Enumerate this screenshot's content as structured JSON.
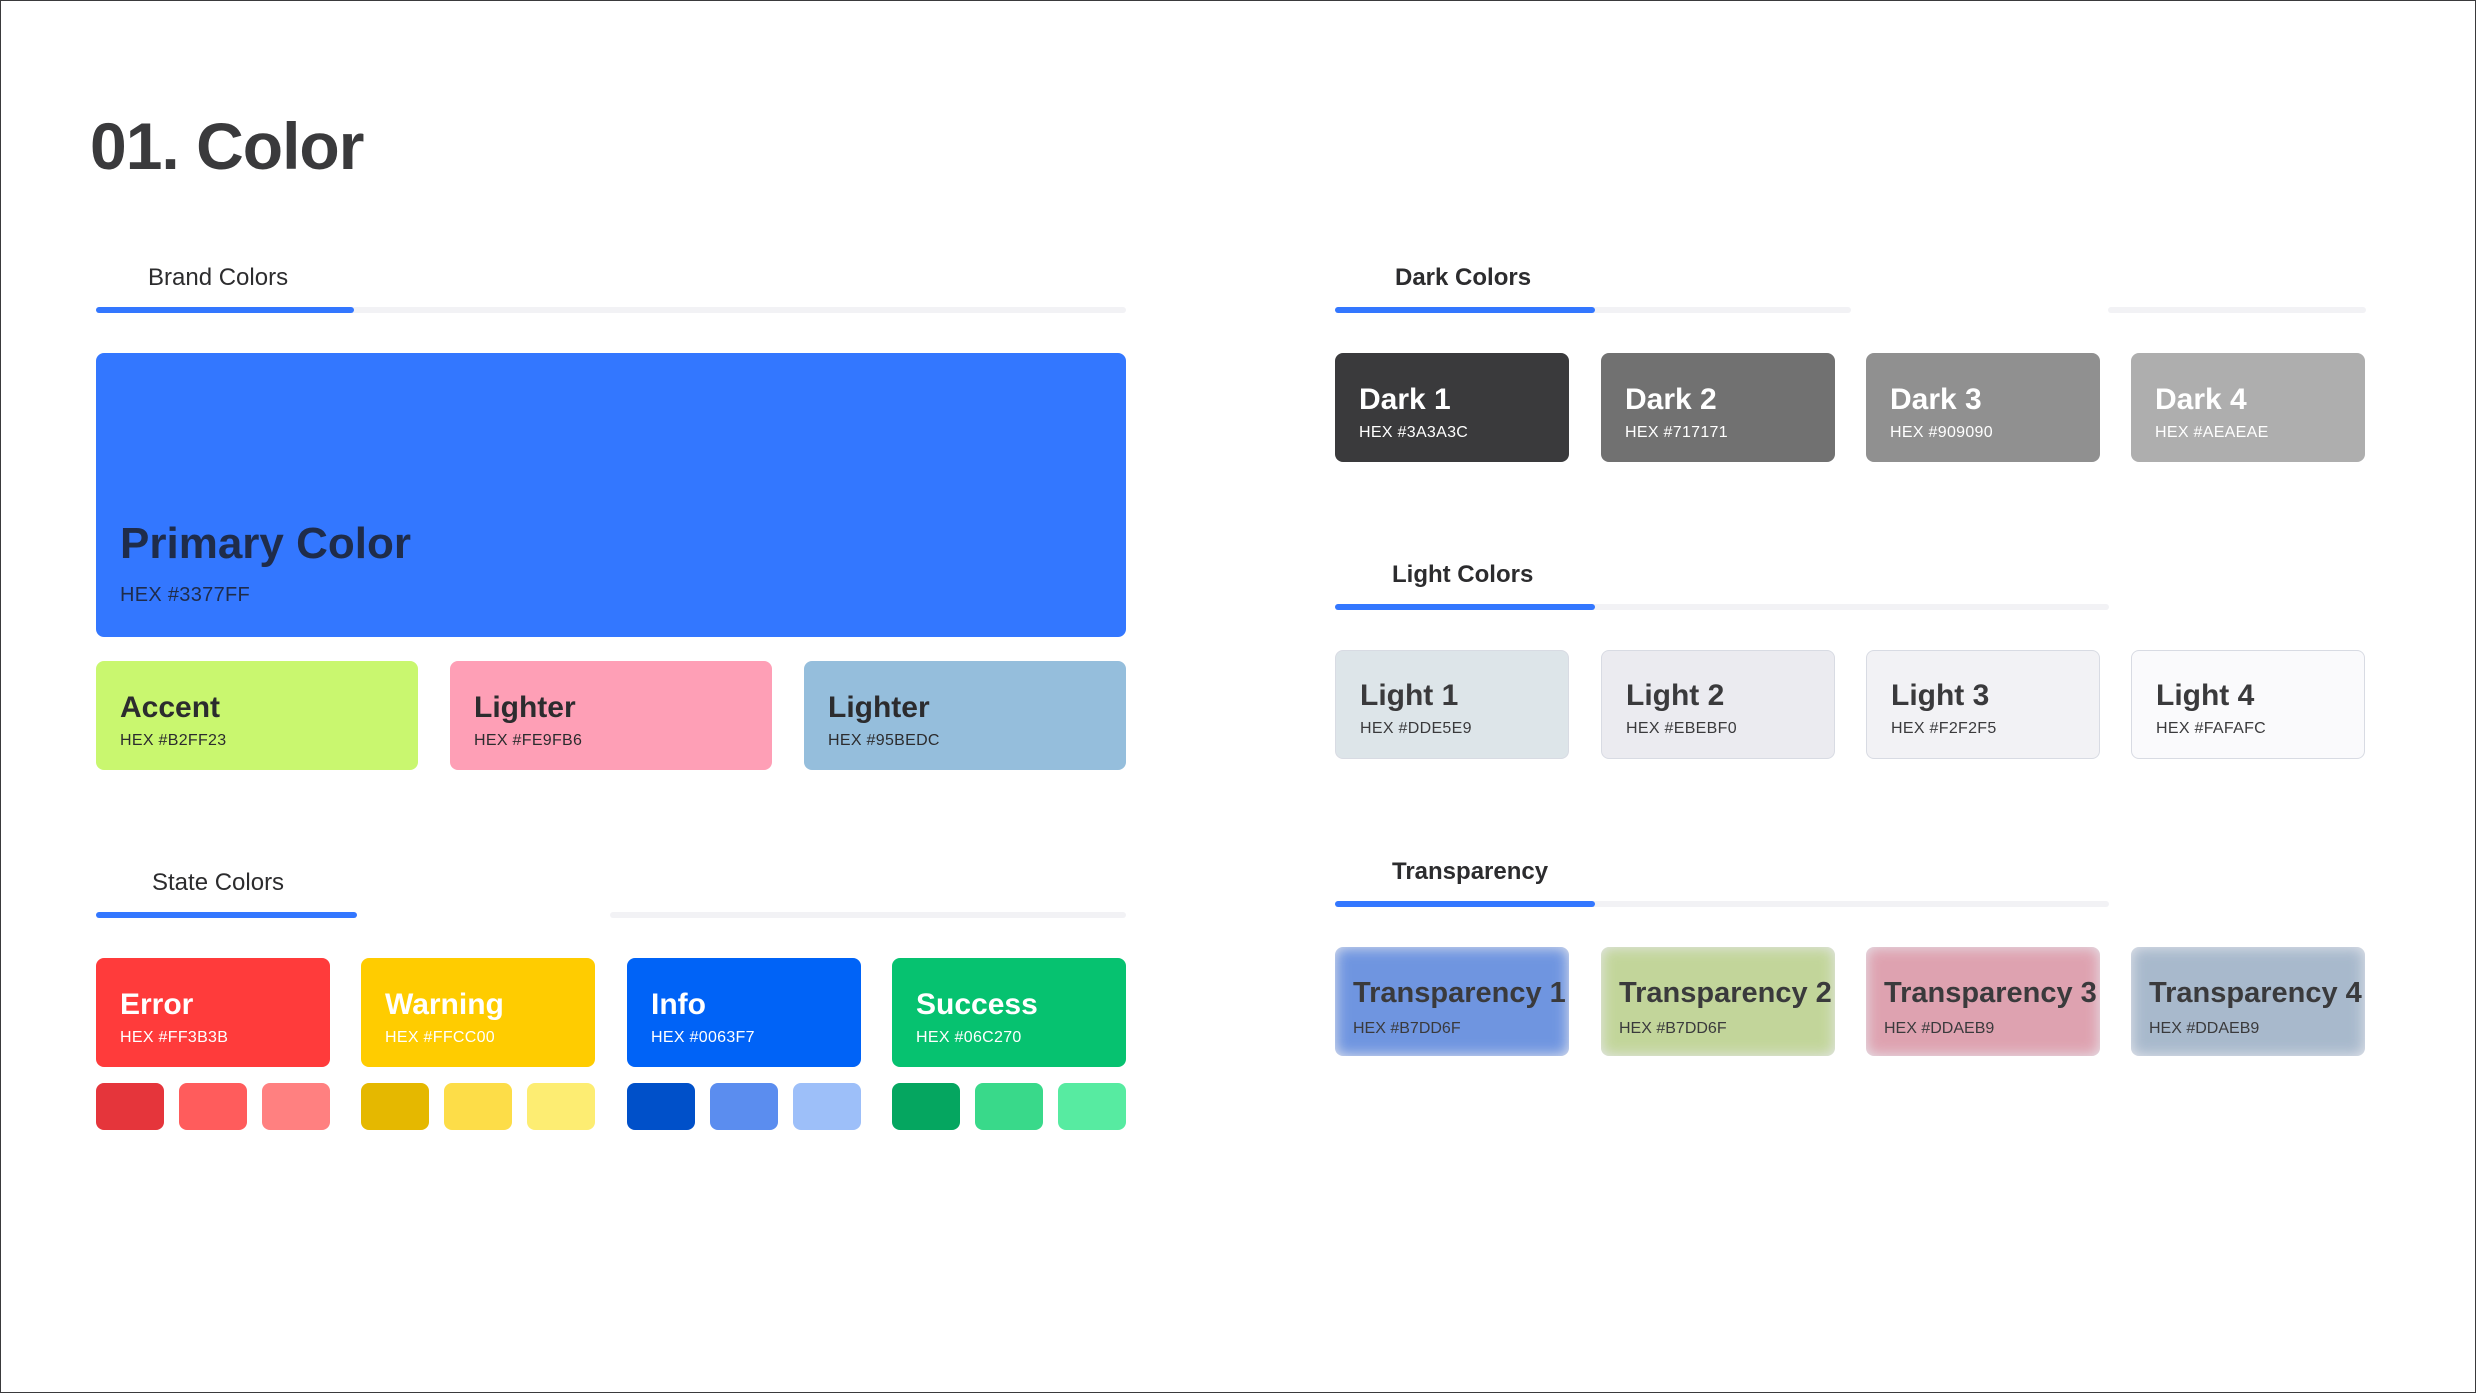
{
  "title": "01. Color",
  "brand": {
    "title": "Brand Colors",
    "primary": {
      "name": "Primary Color",
      "hex": "HEX #3377FF",
      "color": "#3377ff"
    },
    "accent": {
      "name": "Accent",
      "hex": "HEX #B2FF23",
      "color": "#c9f76f"
    },
    "lighter_pink": {
      "name": "Lighter",
      "hex": "HEX #FE9FB6",
      "color": "#fe9fb6"
    },
    "lighter_blue": {
      "name": "Lighter",
      "hex": "HEX #95BEDC",
      "color": "#95bedc"
    }
  },
  "state": {
    "title": "State Colors",
    "items": [
      {
        "name": "Error",
        "hex": "HEX #FF3B3B",
        "color": "#ff3b3b",
        "shades": [
          "#e5353b",
          "#ff5c5c",
          "#ff8080"
        ]
      },
      {
        "name": "Warning",
        "hex": "HEX #FFCC00",
        "color": "#ffcc00",
        "shades": [
          "#e5b800",
          "#fddd48",
          "#fded72"
        ]
      },
      {
        "name": "Info",
        "hex": "HEX #0063F7",
        "color": "#0063f7",
        "shades": [
          "#0050c9",
          "#5b8def",
          "#9dbff9"
        ]
      },
      {
        "name": "Success",
        "hex": "HEX #06C270",
        "color": "#06c270",
        "shades": [
          "#05a660",
          "#39d98a",
          "#57eba1"
        ]
      }
    ]
  },
  "dark": {
    "title": "Dark Colors",
    "items": [
      {
        "name": "Dark 1",
        "hex": "HEX #3A3A3C",
        "color": "#3a3a3c"
      },
      {
        "name": "Dark 2",
        "hex": "HEX #717171",
        "color": "#717171"
      },
      {
        "name": "Dark 3",
        "hex": "HEX #909090",
        "color": "#909090"
      },
      {
        "name": "Dark 4",
        "hex": "HEX #AEAEAE",
        "color": "#aeaeae"
      }
    ]
  },
  "light": {
    "title": "Light Colors",
    "items": [
      {
        "name": "Light 1",
        "hex": "HEX #DDE5E9",
        "color": "#dde5e9"
      },
      {
        "name": "Light 2",
        "hex": "HEX #EBEBF0",
        "color": "#ebebf0"
      },
      {
        "name": "Light 3",
        "hex": "HEX #F2F2F5",
        "color": "#f2f2f5"
      },
      {
        "name": "Light 4",
        "hex": "HEX #FAFAFC",
        "color": "#fafafc"
      }
    ]
  },
  "transparency": {
    "title": "Transparency",
    "items": [
      {
        "name": "Transparency 1",
        "hex": "HEX #B7DD6F",
        "color": "#6f95e0"
      },
      {
        "name": "Transparency 2",
        "hex": "HEX #B7DD6F",
        "color": "#c2d59a"
      },
      {
        "name": "Transparency 3",
        "hex": "HEX #DDAEB9",
        "color": "#dea2b0"
      },
      {
        "name": "Transparency 4",
        "hex": "HEX #DDAEB9",
        "color": "#a8b9cc"
      }
    ]
  }
}
